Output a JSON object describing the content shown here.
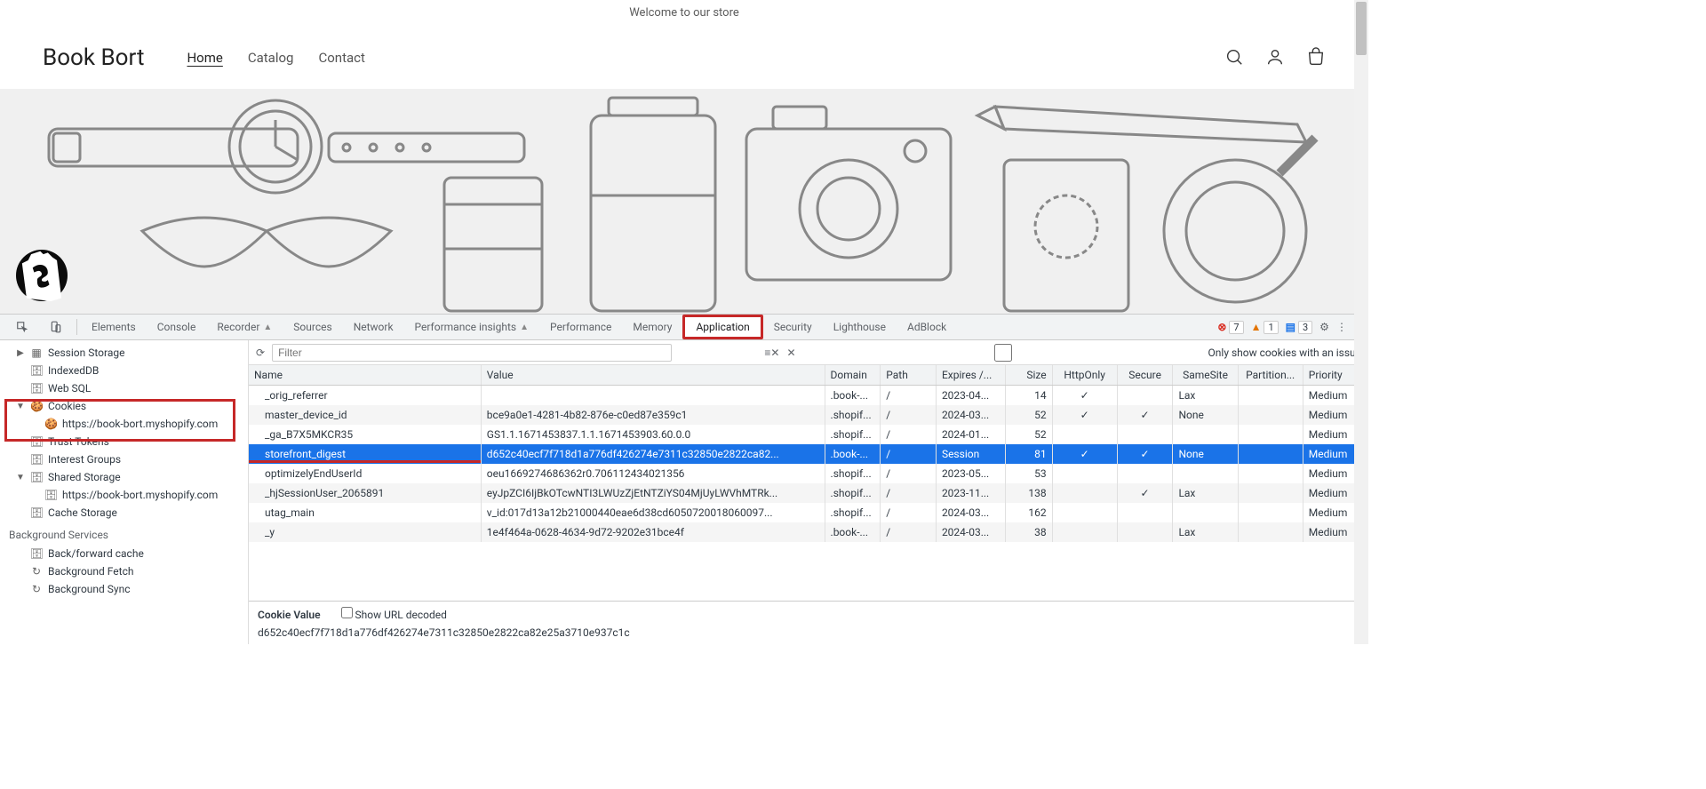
{
  "store": {
    "welcome": "Welcome to our store",
    "title": "Book Bort",
    "nav": {
      "home": "Home",
      "catalog": "Catalog",
      "contact": "Contact"
    }
  },
  "devtools": {
    "tabs": [
      "Elements",
      "Console",
      "Recorder",
      "Sources",
      "Network",
      "Performance insights",
      "Performance",
      "Memory",
      "Application",
      "Security",
      "Lighthouse",
      "AdBlock"
    ],
    "errors": "7",
    "warnings": "1",
    "messages": "3"
  },
  "sidebar": {
    "items": [
      {
        "label": "Session Storage",
        "icon": "grid",
        "level": 1,
        "tri": "▶"
      },
      {
        "label": "IndexedDB",
        "icon": "db",
        "level": 1,
        "tri": ""
      },
      {
        "label": "Web SQL",
        "icon": "db",
        "level": 1,
        "tri": ""
      },
      {
        "label": "Cookies",
        "icon": "cookie",
        "level": 1,
        "tri": "▼"
      },
      {
        "label": "https://book-bort.myshopify.com",
        "icon": "cookie",
        "level": 2,
        "tri": ""
      },
      {
        "label": "Trust Tokens",
        "icon": "db",
        "level": 1,
        "tri": ""
      },
      {
        "label": "Interest Groups",
        "icon": "db",
        "level": 1,
        "tri": ""
      },
      {
        "label": "Shared Storage",
        "icon": "db",
        "level": 1,
        "tri": "▼"
      },
      {
        "label": "https://book-bort.myshopify.com",
        "icon": "",
        "level": 2,
        "tri": ""
      },
      {
        "label": "Cache Storage",
        "icon": "db",
        "level": 1,
        "tri": ""
      }
    ],
    "background_title": "Background Services",
    "bg_items": [
      {
        "label": "Back/forward cache",
        "icon": "db"
      },
      {
        "label": "Background Fetch",
        "icon": "sync"
      },
      {
        "label": "Background Sync",
        "icon": "sync"
      }
    ]
  },
  "filter": {
    "placeholder": "Filter",
    "issue_label": "Only show cookies with an issue"
  },
  "columns": [
    "Name",
    "Value",
    "Domain",
    "Path",
    "Expires /...",
    "Size",
    "HttpOnly",
    "Secure",
    "SameSite",
    "Partition...",
    "Priority"
  ],
  "rows": [
    {
      "name": "_orig_referrer",
      "value": "",
      "domain": ".book-...",
      "path": "/",
      "expires": "2023-04...",
      "size": "14",
      "httponly": "✓",
      "secure": "",
      "samesite": "Lax",
      "partition": "",
      "priority": "Medium"
    },
    {
      "name": "master_device_id",
      "value": "bce9a0e1-4281-4b82-876e-c0ed87e359c1",
      "domain": ".shopif...",
      "path": "/",
      "expires": "2024-03...",
      "size": "52",
      "httponly": "✓",
      "secure": "✓",
      "samesite": "None",
      "partition": "",
      "priority": "Medium"
    },
    {
      "name": "_ga_B7X5MKCR35",
      "value": "GS1.1.1671453837.1.1.1671453903.60.0.0",
      "domain": ".shopif...",
      "path": "/",
      "expires": "2024-01...",
      "size": "52",
      "httponly": "",
      "secure": "",
      "samesite": "",
      "partition": "",
      "priority": "Medium"
    },
    {
      "name": "storefront_digest",
      "value": "d652c40ecf7f718d1a776df426274e7311c32850e2822ca82...",
      "domain": ".book-...",
      "path": "/",
      "expires": "Session",
      "size": "81",
      "httponly": "✓",
      "secure": "✓",
      "samesite": "None",
      "partition": "",
      "priority": "Medium",
      "selected": true
    },
    {
      "name": "optimizelyEndUserId",
      "value": "oeu1669274686362r0.706112434021356",
      "domain": ".shopif...",
      "path": "/",
      "expires": "2023-05...",
      "size": "53",
      "httponly": "",
      "secure": "",
      "samesite": "",
      "partition": "",
      "priority": "Medium"
    },
    {
      "name": "_hjSessionUser_2065891",
      "value": "eyJpZCI6IjBkOTcwNTI3LWUzZjEtNTZiYS04MjUyLWVhMTRk...",
      "domain": ".shopif...",
      "path": "/",
      "expires": "2023-11...",
      "size": "138",
      "httponly": "",
      "secure": "✓",
      "samesite": "Lax",
      "partition": "",
      "priority": "Medium"
    },
    {
      "name": "utag_main",
      "value": "v_id:017d13a12b21000440eae6d38cd6050720018060097...",
      "domain": ".shopif...",
      "path": "/",
      "expires": "2024-03...",
      "size": "162",
      "httponly": "",
      "secure": "",
      "samesite": "",
      "partition": "",
      "priority": "Medium"
    },
    {
      "name": "_y",
      "value": "1e4f464a-0628-4634-9d72-9202e31bce4f",
      "domain": ".book-...",
      "path": "/",
      "expires": "2024-03...",
      "size": "38",
      "httponly": "",
      "secure": "",
      "samesite": "Lax",
      "partition": "",
      "priority": "Medium"
    }
  ],
  "detail": {
    "label": "Cookie Value",
    "checkbox": "Show URL decoded",
    "value": "d652c40ecf7f718d1a776df426274e7311c32850e2822ca82e25a3710e937c1c"
  }
}
